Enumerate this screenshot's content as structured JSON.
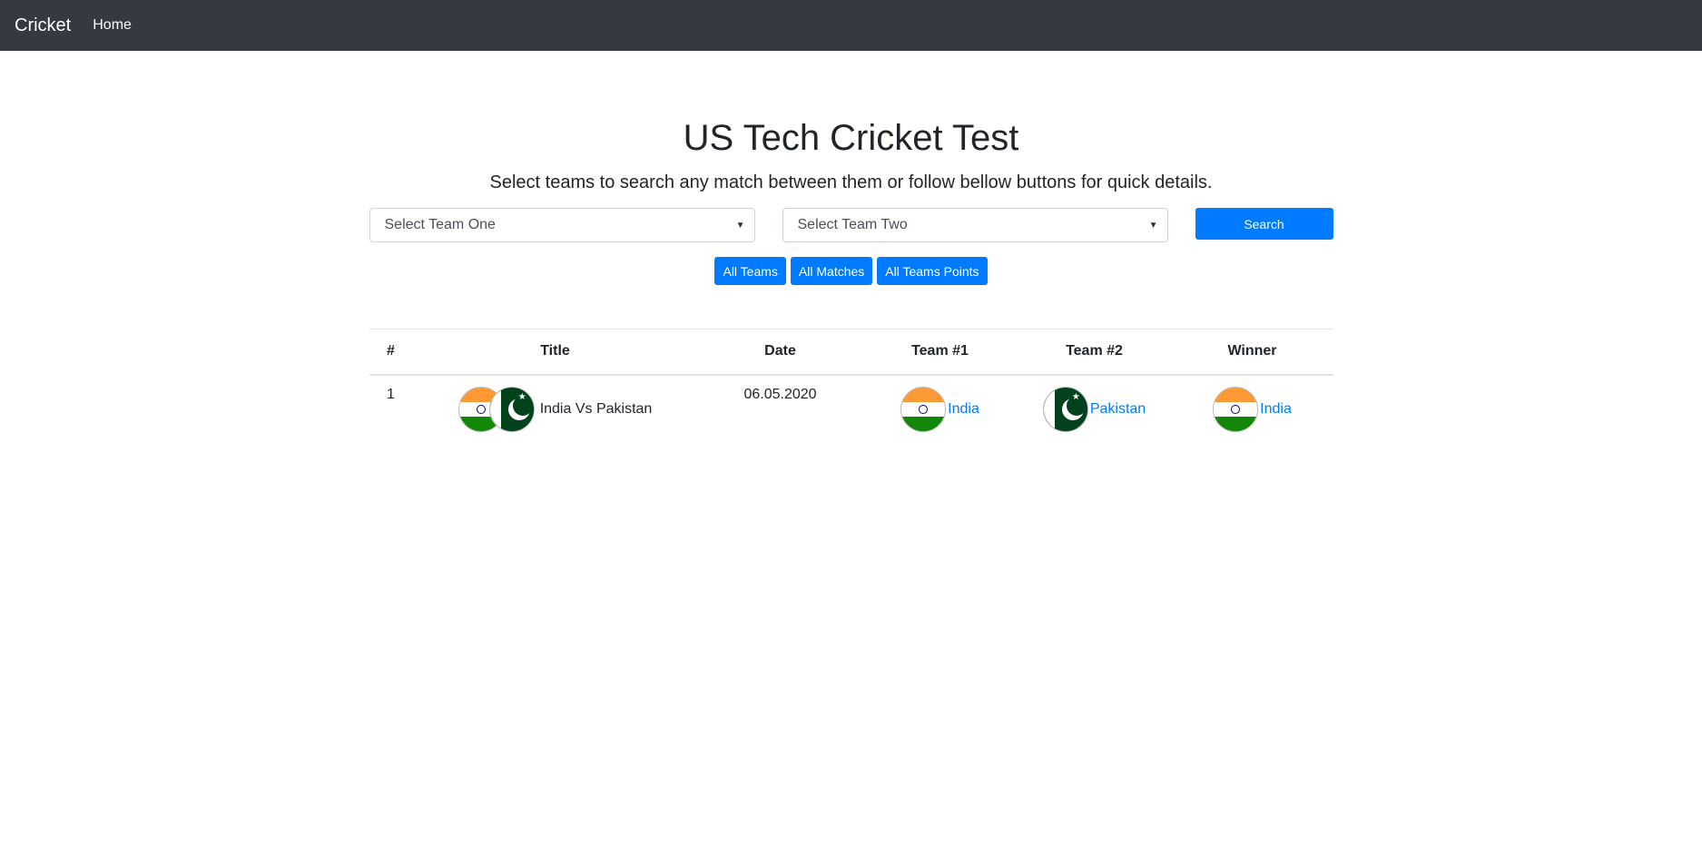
{
  "navbar": {
    "brand": "Cricket",
    "home": "Home"
  },
  "main": {
    "title": "US Tech Cricket Test",
    "subtitle": "Select teams to search any match between them or follow bellow buttons for quick details.",
    "team_one_select": "Select Team One",
    "team_two_select": "Select Team Two",
    "search_label": "Search",
    "quick_buttons": [
      "All Teams",
      "All Matches",
      "All Teams Points"
    ]
  },
  "table": {
    "headers": [
      "#",
      "Title",
      "Date",
      "Team #1",
      "Team #2",
      "Winner"
    ],
    "rows": [
      {
        "num": "1",
        "title": "India Vs Pakistan",
        "date": "06.05.2020",
        "team1": "India",
        "team2": "Pakistan",
        "winner": "India"
      }
    ]
  },
  "icons": {
    "caret": "chevron-down-icon",
    "india_flag": "india-flag-icon",
    "pakistan_flag": "pakistan-flag-icon"
  },
  "colors": {
    "navbar": "#343a40",
    "primary": "#007bff",
    "text": "#212529"
  }
}
